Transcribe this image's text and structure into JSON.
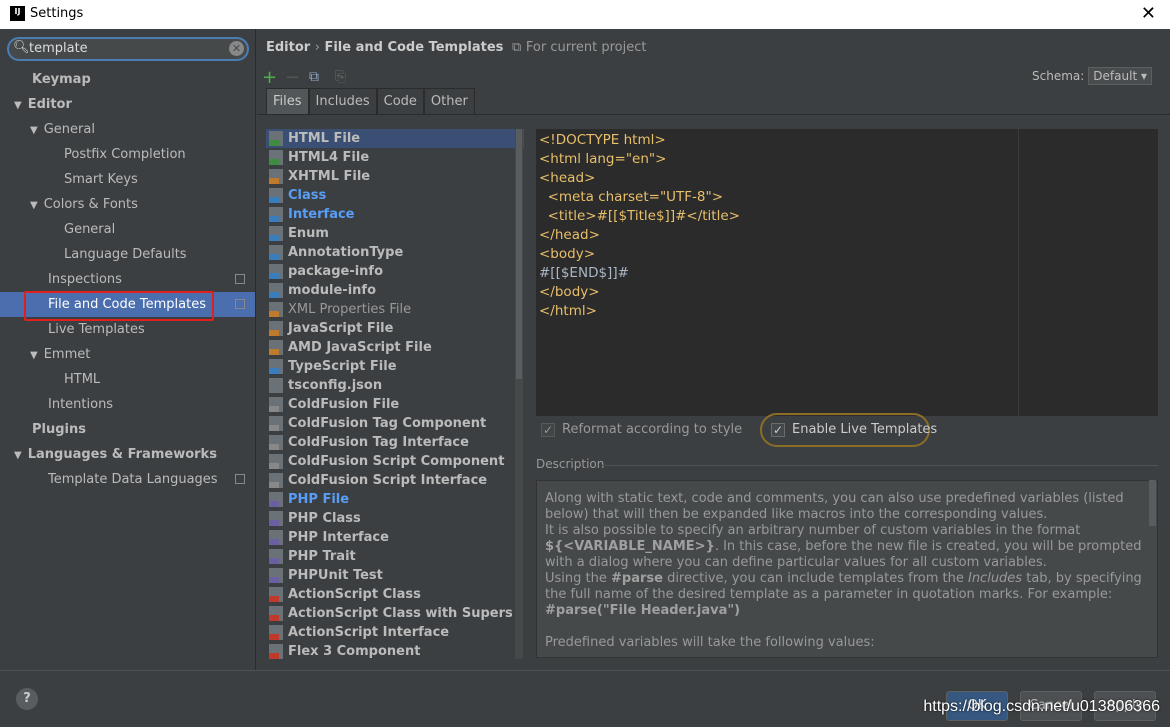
{
  "window": {
    "title": "Settings",
    "logo": "IJ",
    "close": "✕"
  },
  "search": {
    "value": "template"
  },
  "tree": [
    {
      "label": "Keymap",
      "level": 0,
      "bold": true
    },
    {
      "label": "Editor",
      "level": 0,
      "bold": true,
      "arrow": "▼"
    },
    {
      "label": "General",
      "level": 1,
      "arrow": "▼"
    },
    {
      "label": "Postfix Completion",
      "level": 2
    },
    {
      "label": "Smart Keys",
      "level": 2
    },
    {
      "label": "Colors & Fonts",
      "level": 1,
      "arrow": "▼"
    },
    {
      "label": "General",
      "level": 2
    },
    {
      "label": "Language Defaults",
      "level": 2
    },
    {
      "label": "Inspections",
      "level": 1,
      "copy": true
    },
    {
      "label": "File and Code Templates",
      "level": 1,
      "copy": true,
      "selected": true
    },
    {
      "label": "Live Templates",
      "level": 1
    },
    {
      "label": "Emmet",
      "level": 1,
      "arrow": "▼"
    },
    {
      "label": "HTML",
      "level": 2
    },
    {
      "label": "Intentions",
      "level": 1
    },
    {
      "label": "Plugins",
      "level": 0,
      "bold": true
    },
    {
      "label": "Languages & Frameworks",
      "level": 0,
      "bold": true,
      "arrow": "▼"
    },
    {
      "label": "Template Data Languages",
      "level": 1,
      "copy": true
    }
  ],
  "header": {
    "crumb1": "Editor",
    "sep": "›",
    "crumb2": "File and Code Templates",
    "scope": "For current project"
  },
  "toolbar": {
    "add": "+",
    "remove": "−"
  },
  "schema": {
    "label": "Schema:",
    "value": "Default"
  },
  "tabs": [
    "Files",
    "Includes",
    "Code",
    "Other"
  ],
  "active_tab": "Files",
  "templates": [
    {
      "name": "HTML File",
      "icon": "H",
      "color": "#3d8c40",
      "selected": true
    },
    {
      "name": "HTML4 File",
      "icon": "H",
      "color": "#3d8c40"
    },
    {
      "name": "XHTML File",
      "icon": "H",
      "color": "#c07a2c"
    },
    {
      "name": "Class",
      "icon": "J",
      "color": "#3a7dbd",
      "blue": true
    },
    {
      "name": "Interface",
      "icon": "J",
      "color": "#3a7dbd",
      "blue": true
    },
    {
      "name": "Enum",
      "icon": "J",
      "color": "#3a7dbd"
    },
    {
      "name": "AnnotationType",
      "icon": "J",
      "color": "#3a7dbd"
    },
    {
      "name": "package-info",
      "icon": "J",
      "color": "#3a7dbd"
    },
    {
      "name": "module-info",
      "icon": "J",
      "color": "#3a7dbd"
    },
    {
      "name": "XML Properties File",
      "icon": "<>",
      "color": "#c07a2c",
      "plain": true
    },
    {
      "name": "JavaScript File",
      "icon": "JS",
      "color": "#c07a2c"
    },
    {
      "name": "AMD JavaScript File",
      "icon": "JS",
      "color": "#c07a2c"
    },
    {
      "name": "TypeScript File",
      "icon": "TS",
      "color": "#3a7dbd"
    },
    {
      "name": "tsconfig.json",
      "icon": "{}",
      "color": "#6a7278"
    },
    {
      "name": "ColdFusion File",
      "icon": "CF",
      "color": "#888"
    },
    {
      "name": "ColdFusion Tag Component",
      "icon": "CF",
      "color": "#888"
    },
    {
      "name": "ColdFusion Tag Interface",
      "icon": "CF",
      "color": "#888"
    },
    {
      "name": "ColdFusion Script Component",
      "icon": "CF",
      "color": "#888"
    },
    {
      "name": "ColdFusion Script Interface",
      "icon": "CF",
      "color": "#888"
    },
    {
      "name": "PHP File",
      "icon": "php",
      "color": "#6a5fa0",
      "blue": true
    },
    {
      "name": "PHP Class",
      "icon": "php",
      "color": "#6a5fa0"
    },
    {
      "name": "PHP Interface",
      "icon": "php",
      "color": "#6a5fa0"
    },
    {
      "name": "PHP Trait",
      "icon": "php",
      "color": "#6a5fa0"
    },
    {
      "name": "PHPUnit Test",
      "icon": "php",
      "color": "#6a5fa0"
    },
    {
      "name": "ActionScript Class",
      "icon": "AS",
      "color": "#c0392b"
    },
    {
      "name": "ActionScript Class with Supers",
      "icon": "AS",
      "color": "#c0392b"
    },
    {
      "name": "ActionScript Interface",
      "icon": "AS",
      "color": "#c0392b"
    },
    {
      "name": "Flex 3 Component",
      "icon": "F",
      "color": "#c0392b"
    }
  ],
  "editor": {
    "lines": [
      {
        "t": "<!DOCTYPE html>"
      },
      {
        "t": "<html lang=\"en\">"
      },
      {
        "t": "<head>"
      },
      {
        "t": "  <meta charset=\"UTF-8\">"
      },
      {
        "t": "  <title>#[[$Title$]]#</title>"
      },
      {
        "t": "</head>"
      },
      {
        "t": "<body>"
      },
      {
        "t": "#[[$END$]]#",
        "plain": true
      },
      {
        "t": "</body>"
      },
      {
        "t": "</html>"
      }
    ]
  },
  "options": {
    "reformat": "Reformat according to style",
    "reformat_checked": true,
    "live": "Enable Live Templates",
    "live_checked": true
  },
  "description": {
    "label": "Description",
    "p1": "Along with static text, code and comments, you can also use predefined variables (listed below) that will then be expanded like macros into the corresponding values.",
    "p2a": "It is also possible to specify an arbitrary number of custom variables in the format ",
    "p2b": "${<VARIABLE_NAME>}",
    "p2c": ". In this case, before the new file is created, you will be prompted with a dialog where you can define particular values for all custom variables.",
    "p3a": "Using the ",
    "p3b": "#parse",
    "p3c": " directive, you can include templates from the ",
    "p3d": "Includes",
    "p3e": " tab, by specifying the full name of the desired template as a parameter in quotation marks. For example:",
    "p4": "#parse(\"File Header.java\")",
    "p5": "Predefined variables will take the following values:"
  },
  "buttons": {
    "help": "?",
    "ok": "OK",
    "cancel": "Cancel",
    "apply": "Apply"
  },
  "watermark": "https://blog.csdn.net/u013806366"
}
